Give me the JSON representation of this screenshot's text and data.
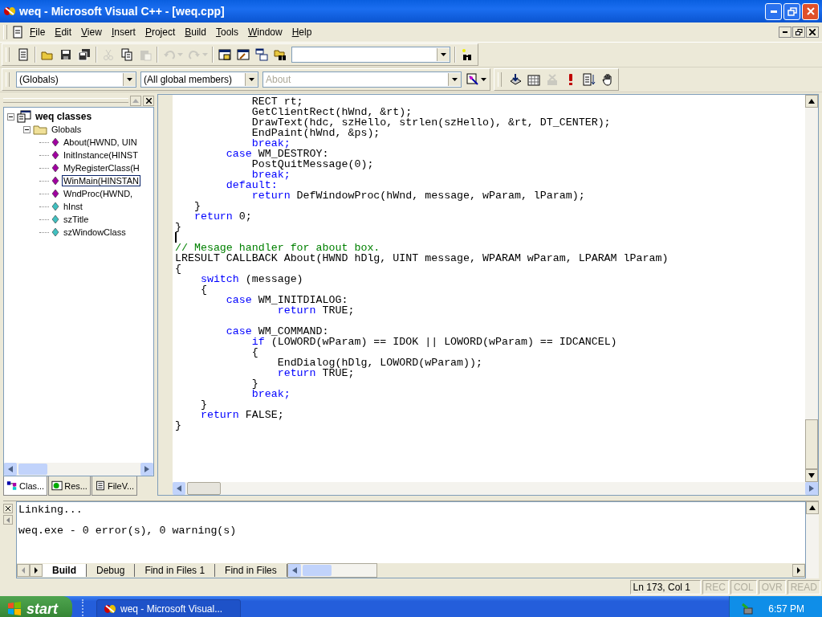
{
  "window": {
    "title": "weq - Microsoft Visual C++ - [weq.cpp]"
  },
  "menu": [
    "File",
    "Edit",
    "View",
    "Insert",
    "Project",
    "Build",
    "Tools",
    "Window",
    "Help"
  ],
  "standard_toolbar": [
    {
      "kind": "new",
      "disabled": false
    },
    {
      "kind": "open",
      "disabled": false
    },
    {
      "kind": "save",
      "disabled": false
    },
    {
      "kind": "save-all",
      "disabled": false
    },
    {
      "kind": "cut",
      "disabled": true
    },
    {
      "kind": "copy",
      "disabled": false
    },
    {
      "kind": "paste",
      "disabled": true
    },
    {
      "kind": "undo",
      "disabled": true
    },
    {
      "kind": "redo",
      "disabled": true
    },
    {
      "kind": "workspace",
      "disabled": false
    },
    {
      "kind": "output",
      "disabled": false
    },
    {
      "kind": "windows",
      "disabled": false
    },
    {
      "kind": "find-in-files",
      "disabled": false
    }
  ],
  "wizard_bar": {
    "class_combo": "(Globals)",
    "members_combo": "(All global members)",
    "function_combo": {
      "value": "About",
      "disabled": true
    }
  },
  "build_toolbar": [
    {
      "kind": "compile",
      "disabled": false
    },
    {
      "kind": "build",
      "disabled": false
    },
    {
      "kind": "stop",
      "disabled": true
    },
    {
      "kind": "execute",
      "disabled": false
    },
    {
      "kind": "go",
      "disabled": false
    },
    {
      "kind": "breakpoint",
      "disabled": false
    }
  ],
  "workspace": {
    "tree": [
      {
        "label": "weq classes",
        "kind": "classes",
        "expanded": true,
        "selected": false,
        "children": [
          {
            "label": "Globals",
            "kind": "folder",
            "expanded": true,
            "selected": false,
            "children": [
              {
                "label": "About(HWND, UIN",
                "kind": "function",
                "selected": false
              },
              {
                "label": "InitInstance(HINST",
                "kind": "function",
                "selected": false
              },
              {
                "label": "MyRegisterClass(H",
                "kind": "function",
                "selected": false
              },
              {
                "label": "WinMain(HINSTAN",
                "kind": "function",
                "selected": true
              },
              {
                "label": "WndProc(HWND,",
                "kind": "function",
                "selected": false
              },
              {
                "label": "hInst",
                "kind": "variable",
                "selected": false
              },
              {
                "label": "szTitle",
                "kind": "variable",
                "selected": false
              },
              {
                "label": "szWindowClass",
                "kind": "variable",
                "selected": false
              }
            ]
          }
        ]
      }
    ],
    "tabs": [
      {
        "label": "Clas...",
        "kind": "class",
        "selected": true
      },
      {
        "label": "Res...",
        "kind": "resource",
        "selected": false
      },
      {
        "label": "FileV...",
        "kind": "file",
        "selected": false
      }
    ]
  },
  "editor": {
    "lines": [
      {
        "kind": "code",
        "segments": [
          {
            "kind": "plain",
            "text": "            RECT rt;"
          }
        ]
      },
      {
        "kind": "code",
        "segments": [
          {
            "kind": "plain",
            "text": "            GetClientRect(hWnd, &rt);"
          }
        ]
      },
      {
        "kind": "code",
        "segments": [
          {
            "kind": "plain",
            "text": "            DrawText(hdc, szHello, strlen(szHello), &rt, DT_CENTER);"
          }
        ]
      },
      {
        "kind": "code",
        "segments": [
          {
            "kind": "plain",
            "text": "            EndPaint(hWnd, &ps);"
          }
        ]
      },
      {
        "kind": "code",
        "segments": [
          {
            "kind": "keyword",
            "text": "            break;"
          }
        ]
      },
      {
        "kind": "code",
        "segments": [
          {
            "kind": "keyword",
            "text": "        case"
          },
          {
            "kind": "plain",
            "text": " WM_DESTROY:"
          }
        ]
      },
      {
        "kind": "code",
        "segments": [
          {
            "kind": "plain",
            "text": "            PostQuitMessage(0);"
          }
        ]
      },
      {
        "kind": "code",
        "segments": [
          {
            "kind": "keyword",
            "text": "            break;"
          }
        ]
      },
      {
        "kind": "code",
        "segments": [
          {
            "kind": "keyword",
            "text": "        default:"
          }
        ]
      },
      {
        "kind": "code",
        "segments": [
          {
            "kind": "keyword",
            "text": "            return"
          },
          {
            "kind": "plain",
            "text": " DefWindowProc(hWnd, message, wParam, lParam);"
          }
        ]
      },
      {
        "kind": "code",
        "segments": [
          {
            "kind": "plain",
            "text": "   }"
          }
        ]
      },
      {
        "kind": "code",
        "segments": [
          {
            "kind": "keyword",
            "text": "   return"
          },
          {
            "kind": "plain",
            "text": " 0;"
          }
        ]
      },
      {
        "kind": "code",
        "segments": [
          {
            "kind": "plain",
            "text": "}"
          }
        ]
      },
      {
        "kind": "caret"
      },
      {
        "kind": "code",
        "segments": [
          {
            "kind": "comment",
            "text": "// Mesage handler for about box."
          }
        ]
      },
      {
        "kind": "code",
        "segments": [
          {
            "kind": "plain",
            "text": "LRESULT CALLBACK About(HWND hDlg, UINT message, WPARAM wParam, LPARAM lParam)"
          }
        ]
      },
      {
        "kind": "code",
        "segments": [
          {
            "kind": "plain",
            "text": "{"
          }
        ]
      },
      {
        "kind": "code",
        "segments": [
          {
            "kind": "keyword",
            "text": "    switch"
          },
          {
            "kind": "plain",
            "text": " (message)"
          }
        ]
      },
      {
        "kind": "code",
        "segments": [
          {
            "kind": "plain",
            "text": "    {"
          }
        ]
      },
      {
        "kind": "code",
        "segments": [
          {
            "kind": "keyword",
            "text": "        case"
          },
          {
            "kind": "plain",
            "text": " WM_INITDIALOG:"
          }
        ]
      },
      {
        "kind": "code",
        "segments": [
          {
            "kind": "keyword",
            "text": "                return"
          },
          {
            "kind": "plain",
            "text": " TRUE;"
          }
        ]
      },
      {
        "kind": "blank"
      },
      {
        "kind": "code",
        "segments": [
          {
            "kind": "keyword",
            "text": "        case"
          },
          {
            "kind": "plain",
            "text": " WM_COMMAND:"
          }
        ]
      },
      {
        "kind": "code",
        "segments": [
          {
            "kind": "keyword",
            "text": "            if"
          },
          {
            "kind": "plain",
            "text": " (LOWORD(wParam) == IDOK || LOWORD(wParam) == IDCANCEL)"
          }
        ]
      },
      {
        "kind": "code",
        "segments": [
          {
            "kind": "plain",
            "text": "            {"
          }
        ]
      },
      {
        "kind": "code",
        "segments": [
          {
            "kind": "plain",
            "text": "                EndDialog(hDlg, LOWORD(wParam));"
          }
        ]
      },
      {
        "kind": "code",
        "segments": [
          {
            "kind": "keyword",
            "text": "                return"
          },
          {
            "kind": "plain",
            "text": " TRUE;"
          }
        ]
      },
      {
        "kind": "code",
        "segments": [
          {
            "kind": "plain",
            "text": "            }"
          }
        ]
      },
      {
        "kind": "code",
        "segments": [
          {
            "kind": "keyword",
            "text": "            break;"
          }
        ]
      },
      {
        "kind": "code",
        "segments": [
          {
            "kind": "plain",
            "text": "    }"
          }
        ]
      },
      {
        "kind": "code",
        "segments": [
          {
            "kind": "keyword",
            "text": "    return"
          },
          {
            "kind": "plain",
            "text": " FALSE;"
          }
        ]
      },
      {
        "kind": "code",
        "segments": [
          {
            "kind": "plain",
            "text": "}"
          }
        ]
      }
    ]
  },
  "output": {
    "lines": [
      "Linking...",
      "weq.exe - 0 error(s), 0 warning(s)"
    ],
    "tabs": [
      {
        "label": "Build",
        "selected": true
      },
      {
        "label": "Debug",
        "selected": false
      },
      {
        "label": "Find in Files 1",
        "selected": false
      },
      {
        "label": "Find in Files",
        "selected": false
      }
    ]
  },
  "status_bar": {
    "position": "Ln 173, Col 1",
    "indicators": [
      {
        "label": "REC",
        "on": false
      },
      {
        "label": "COL",
        "on": false
      },
      {
        "label": "OVR",
        "on": false
      },
      {
        "label": "READ",
        "on": false
      }
    ]
  },
  "taskbar": {
    "start": "start",
    "tasks": [
      "weq - Microsoft Visual..."
    ],
    "clock": "6:57 PM"
  }
}
